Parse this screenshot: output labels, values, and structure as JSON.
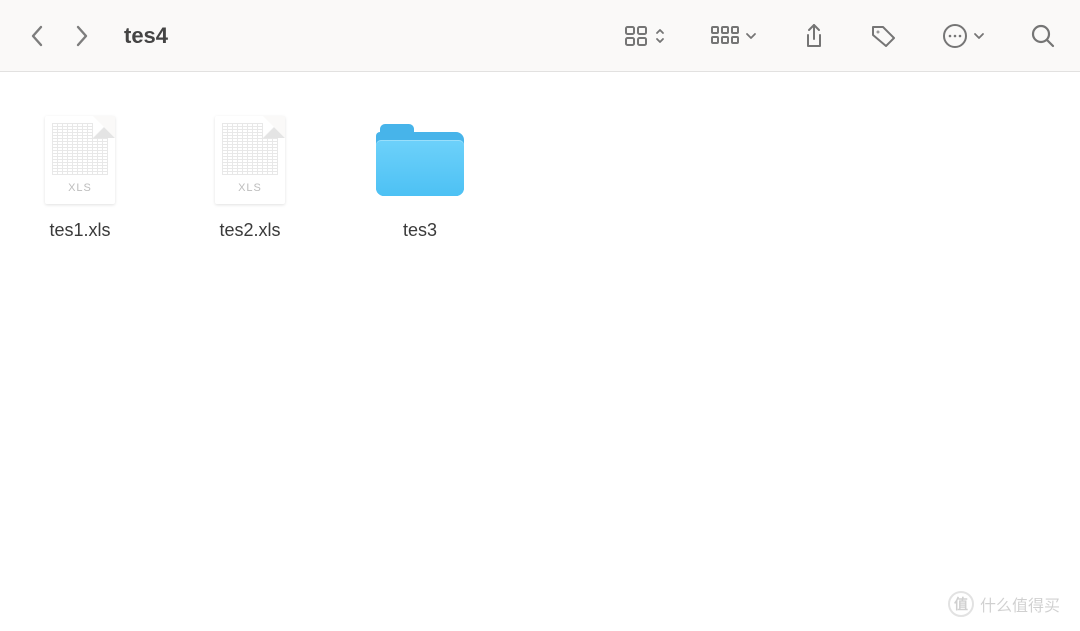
{
  "toolbar": {
    "title": "tes4"
  },
  "items": [
    {
      "name": "tes1.xls",
      "type": "xls",
      "badge": "XLS"
    },
    {
      "name": "tes2.xls",
      "type": "xls",
      "badge": "XLS"
    },
    {
      "name": "tes3",
      "type": "folder"
    }
  ],
  "watermark": {
    "logo": "值",
    "text": "什么值得买"
  }
}
